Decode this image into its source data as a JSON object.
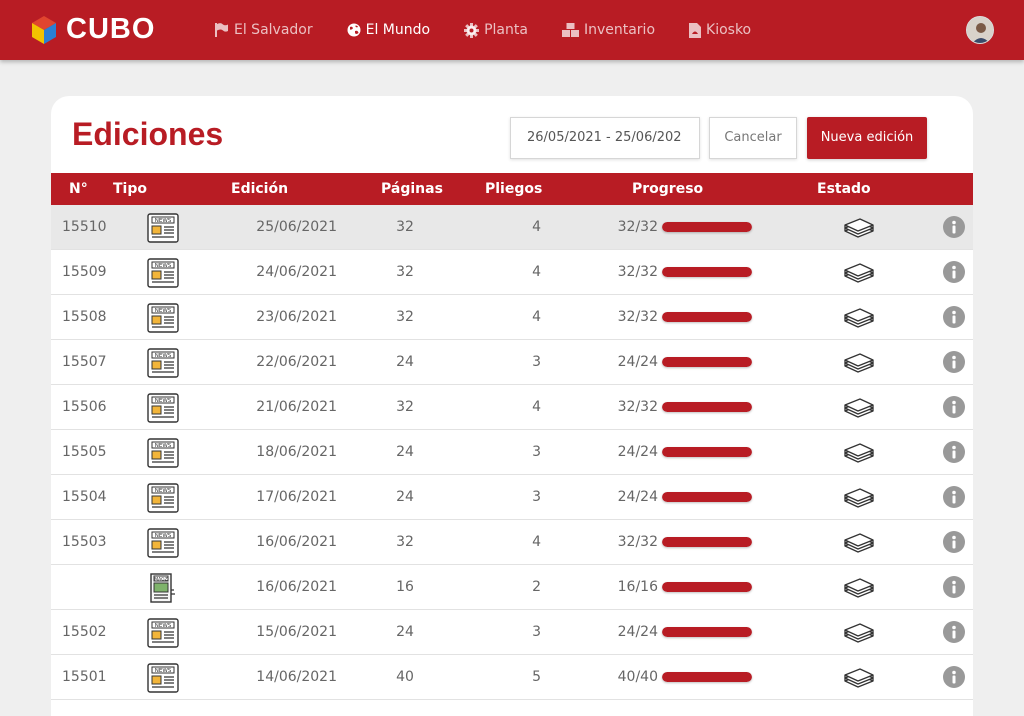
{
  "app": {
    "name": "CUBO"
  },
  "nav": [
    {
      "label": "El Salvador",
      "icon": "flag-icon",
      "active": false
    },
    {
      "label": "El Mundo",
      "icon": "globe-icon",
      "active": true
    },
    {
      "label": "Planta",
      "icon": "gear-icon",
      "active": false
    },
    {
      "label": "Inventario",
      "icon": "boxes-icon",
      "active": false
    },
    {
      "label": "Kiosko",
      "icon": "file-pdf-icon",
      "active": false
    }
  ],
  "page": {
    "title": "Ediciones",
    "date_range": "26/05/2021 - 25/06/202",
    "cancel_label": "Cancelar",
    "new_label": "Nueva edición"
  },
  "table": {
    "headers": [
      "N°",
      "Tipo",
      "Edición",
      "Páginas",
      "Pliegos",
      "Progreso",
      "Estado"
    ],
    "rows": [
      {
        "num": "15510",
        "type": "news",
        "date": "25/06/2021",
        "pages": "32",
        "pliegos": "4",
        "progress": "32/32",
        "fraction": 1.0,
        "selected": true
      },
      {
        "num": "15509",
        "type": "news",
        "date": "24/06/2021",
        "pages": "32",
        "pliegos": "4",
        "progress": "32/32",
        "fraction": 1.0,
        "selected": false
      },
      {
        "num": "15508",
        "type": "news",
        "date": "23/06/2021",
        "pages": "32",
        "pliegos": "4",
        "progress": "32/32",
        "fraction": 1.0,
        "selected": false
      },
      {
        "num": "15507",
        "type": "news",
        "date": "22/06/2021",
        "pages": "24",
        "pliegos": "3",
        "progress": "24/24",
        "fraction": 1.0,
        "selected": false
      },
      {
        "num": "15506",
        "type": "news",
        "date": "21/06/2021",
        "pages": "32",
        "pliegos": "4",
        "progress": "32/32",
        "fraction": 1.0,
        "selected": false
      },
      {
        "num": "15505",
        "type": "news",
        "date": "18/06/2021",
        "pages": "24",
        "pliegos": "3",
        "progress": "24/24",
        "fraction": 1.0,
        "selected": false
      },
      {
        "num": "15504",
        "type": "news",
        "date": "17/06/2021",
        "pages": "24",
        "pliegos": "3",
        "progress": "24/24",
        "fraction": 1.0,
        "selected": false
      },
      {
        "num": "15503",
        "type": "news",
        "date": "16/06/2021",
        "pages": "32",
        "pliegos": "4",
        "progress": "32/32",
        "fraction": 1.0,
        "selected": false
      },
      {
        "num": "",
        "type": "magazine",
        "date": "16/06/2021",
        "pages": "16",
        "pliegos": "2",
        "progress": "16/16",
        "fraction": 1.0,
        "selected": false
      },
      {
        "num": "15502",
        "type": "news",
        "date": "15/06/2021",
        "pages": "24",
        "pliegos": "3",
        "progress": "24/24",
        "fraction": 1.0,
        "selected": false
      },
      {
        "num": "15501",
        "type": "news",
        "date": "14/06/2021",
        "pages": "40",
        "pliegos": "5",
        "progress": "40/40",
        "fraction": 1.0,
        "selected": false
      }
    ]
  },
  "colors": {
    "brand": "#b81c24",
    "background": "#efefef"
  }
}
